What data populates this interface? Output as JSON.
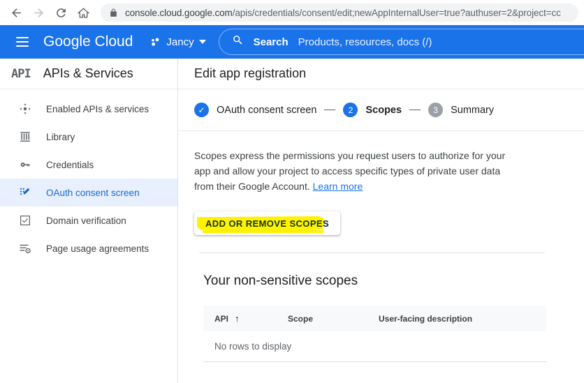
{
  "browser": {
    "back_icon": "back-arrow-icon",
    "forward_icon": "forward-arrow-icon",
    "reload_icon": "reload-icon",
    "home_icon": "home-icon",
    "lock_icon": "lock-icon",
    "url_domain": "console.cloud.google.com",
    "url_path": "/apis/credentials/consent/edit;newAppInternalUser=true?authuser=2&project=cc"
  },
  "topbar": {
    "menu_icon": "hamburger-menu-icon",
    "logo": "Google Cloud",
    "project_icon": "project-dots-icon",
    "project_name": "Jancy",
    "project_caret_icon": "chevron-down-icon",
    "search_icon": "search-icon",
    "search_label": "Search",
    "search_placeholder": "Products, resources, docs (/)",
    "background": "#1a73e8"
  },
  "sidebar": {
    "logo_text": "API",
    "title": "APIs & Services",
    "items": [
      {
        "label": "Enabled APIs & services",
        "icon": "enabled-apis-icon",
        "active": false
      },
      {
        "label": "Library",
        "icon": "library-icon",
        "active": false
      },
      {
        "label": "Credentials",
        "icon": "key-icon",
        "active": false
      },
      {
        "label": "OAuth consent screen",
        "icon": "oauth-consent-icon",
        "active": true
      },
      {
        "label": "Domain verification",
        "icon": "checkbox-icon",
        "active": false
      },
      {
        "label": "Page usage agreements",
        "icon": "page-usage-icon",
        "active": false
      }
    ],
    "active_color": "#1967d2",
    "active_bg": "#e8f0fe"
  },
  "main": {
    "title": "Edit app registration",
    "stepper": [
      {
        "marker": "✓",
        "label": "OAuth consent screen",
        "state": "done"
      },
      {
        "marker": "2",
        "label": "Scopes",
        "state": "current"
      },
      {
        "marker": "3",
        "label": "Summary",
        "state": "pending"
      }
    ],
    "description_text": "Scopes express the permissions you request users to authorize for your app and allow your project to access specific types of private user data from their Google Account. ",
    "description_link": "Learn more",
    "scopes_button": "ADD OR REMOVE SCOPES",
    "highlight_color": "#fff200",
    "table": {
      "heading": "Your non-sensitive scopes",
      "columns": [
        "API",
        "Scope",
        "User-facing description"
      ],
      "sort_indicator": "↑",
      "empty_message": "No rows to display",
      "rows": []
    }
  }
}
